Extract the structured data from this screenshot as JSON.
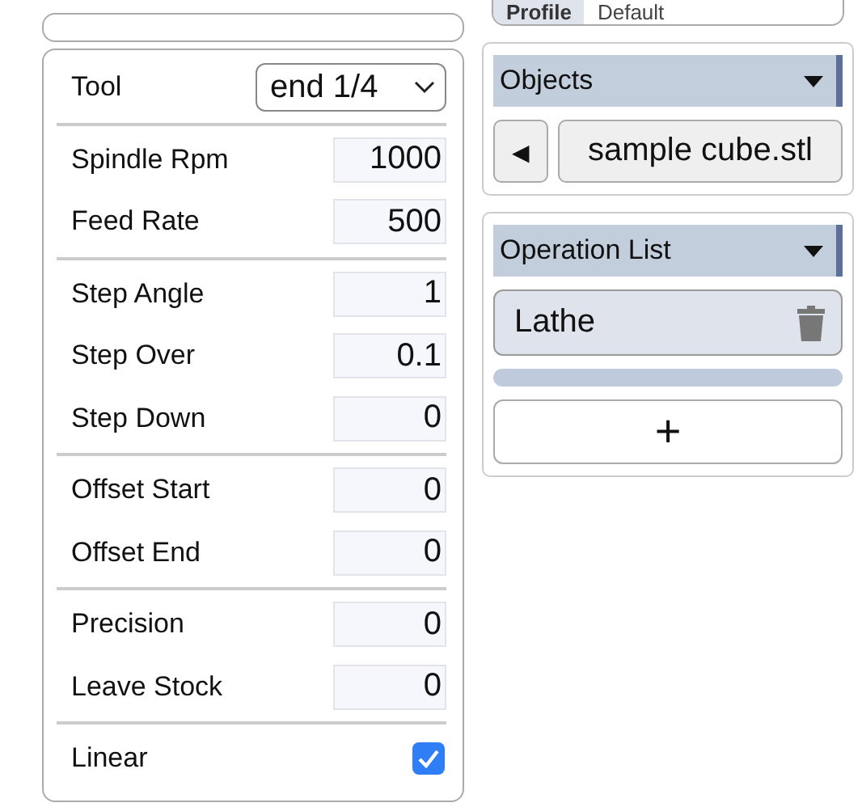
{
  "profile": {
    "label": "Profile",
    "value": "Default"
  },
  "settings": {
    "sections": [
      [
        {
          "kind": "select",
          "label": "Tool",
          "value": "end 1/4"
        }
      ],
      [
        {
          "kind": "number",
          "label": "Spindle Rpm",
          "value": "1000"
        },
        {
          "kind": "number",
          "label": "Feed Rate",
          "value": "500"
        }
      ],
      [
        {
          "kind": "number",
          "label": "Step Angle",
          "value": "1"
        },
        {
          "kind": "number",
          "label": "Step Over",
          "value": "0.1"
        },
        {
          "kind": "number",
          "label": "Step Down",
          "value": "0"
        }
      ],
      [
        {
          "kind": "number",
          "label": "Offset Start",
          "value": "0"
        },
        {
          "kind": "number",
          "label": "Offset End",
          "value": "0"
        }
      ],
      [
        {
          "kind": "number",
          "label": "Precision",
          "value": "0"
        },
        {
          "kind": "number",
          "label": "Leave Stock",
          "value": "0"
        }
      ],
      [
        {
          "kind": "checkbox",
          "label": "Linear",
          "checked": true
        }
      ]
    ]
  },
  "objects": {
    "title": "Objects",
    "back": "◀",
    "file": "sample cube.stl"
  },
  "operations": {
    "title": "Operation List",
    "items": [
      {
        "name": "Lathe"
      }
    ],
    "level": 1,
    "add": "+"
  }
}
